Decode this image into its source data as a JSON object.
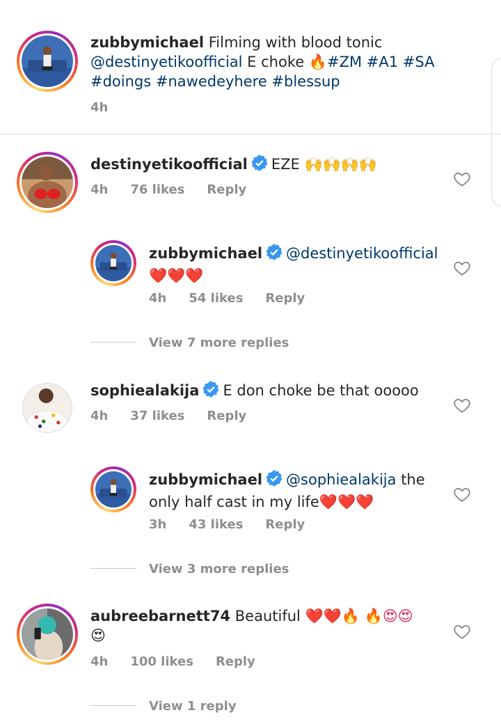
{
  "caption": {
    "username": "zubbymichael",
    "text": "Filming with blood tonic",
    "mention": "@destinyetikoofficial",
    "after_mention": "E choke",
    "emoji_after": "🔥",
    "tags_line1": "#ZM #A1 #SA",
    "tags_line2": "#doings #nawedeyhere #blessup",
    "time": "4h"
  },
  "comments": [
    {
      "username": "destinyetikoofficial",
      "verified": true,
      "text": "EZE",
      "emojis": "🙌🙌🙌🙌",
      "time": "4h",
      "likes": "76 likes",
      "reply": "Reply"
    },
    {
      "username": "zubbymichael",
      "verified": true,
      "mention": "@destinyetikoofficial",
      "emojis": "❤️❤️❤️",
      "time": "4h",
      "likes": "54 likes",
      "reply": "Reply"
    },
    {
      "username": "sophiealakija",
      "verified": true,
      "text": "E don choke be that ooooo",
      "time": "4h",
      "likes": "37 likes",
      "reply": "Reply"
    },
    {
      "username": "zubbymichael",
      "verified": true,
      "mention": "@sophiealakija",
      "text_line1": "the",
      "text_line2": "only half cast in my life",
      "emojis": "❤️❤️❤️",
      "time": "3h",
      "likes": "43 likes",
      "reply": "Reply"
    },
    {
      "username": "aubreebarnett74",
      "verified": false,
      "text": "Beautiful",
      "emojis_line1": "❤️❤️🔥 🔥😍😍",
      "emojis_line2": "😍",
      "time": "4h",
      "likes": "100 likes",
      "reply": "Reply"
    }
  ],
  "view_more": [
    "View 7 more replies",
    "View 3 more replies",
    "View 1 reply"
  ],
  "icons": {
    "like": "heart-outline-icon",
    "verified": "verified-badge-icon"
  },
  "colors": {
    "mention": "#00376b",
    "meta": "#8e8e8e",
    "verified": "#3897f0"
  }
}
